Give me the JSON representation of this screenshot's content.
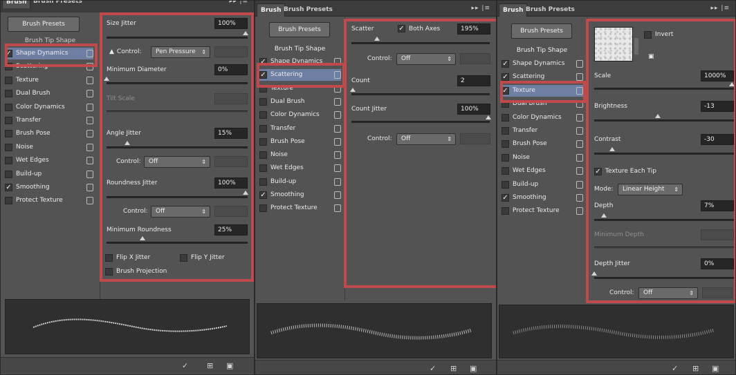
{
  "panel1": {
    "tabs": [
      "Brush",
      "Brush Presets"
    ],
    "presets_button": "Brush Presets",
    "tip_shape": "Brush Tip Shape",
    "list": [
      {
        "label": "Shape Dynamics",
        "checked": true
      },
      {
        "label": "Scattering",
        "checked": false
      },
      {
        "label": "Texture",
        "checked": false
      },
      {
        "label": "Dual Brush",
        "checked": false
      },
      {
        "label": "Color Dynamics",
        "checked": false
      },
      {
        "label": "Transfer",
        "checked": false
      },
      {
        "label": "Brush Pose",
        "checked": false
      },
      {
        "label": "Noise",
        "checked": false
      },
      {
        "label": "Wet Edges",
        "checked": false
      },
      {
        "label": "Build-up",
        "checked": false
      },
      {
        "label": "Smoothing",
        "checked": true
      },
      {
        "label": "Protect Texture",
        "checked": false
      }
    ],
    "size_jitter": {
      "label": "Size Jitter",
      "value": "100%"
    },
    "control1": {
      "label": "Control:",
      "value": "Pen Pressure"
    },
    "min_diameter": {
      "label": "Minimum Diameter",
      "value": "0%"
    },
    "tilt_scale": {
      "label": "Tilt Scale"
    },
    "angle_jitter": {
      "label": "Angle Jitter",
      "value": "15%"
    },
    "control2": {
      "label": "Control:",
      "value": "Off"
    },
    "roundness_jitter": {
      "label": "Roundness Jitter",
      "value": "100%"
    },
    "control3": {
      "label": "Control:",
      "value": "Off"
    },
    "min_roundness": {
      "label": "Minimum Roundness",
      "value": "25%"
    },
    "flip_x": "Flip X Jitter",
    "flip_y": "Flip Y Jitter",
    "brush_projection": "Brush Projection"
  },
  "panel2": {
    "tabs": [
      "Brush",
      "Brush Presets"
    ],
    "presets_button": "Brush Presets",
    "tip_shape": "Brush Tip Shape",
    "list": [
      {
        "label": "Shape Dynamics",
        "checked": true
      },
      {
        "label": "Scattering",
        "checked": true
      },
      {
        "label": "Texture",
        "checked": false
      },
      {
        "label": "Dual Brush",
        "checked": false
      },
      {
        "label": "Color Dynamics",
        "checked": false
      },
      {
        "label": "Transfer",
        "checked": false
      },
      {
        "label": "Brush Pose",
        "checked": false
      },
      {
        "label": "Noise",
        "checked": false
      },
      {
        "label": "Wet Edges",
        "checked": false
      },
      {
        "label": "Build-up",
        "checked": false
      },
      {
        "label": "Smoothing",
        "checked": true
      },
      {
        "label": "Protect Texture",
        "checked": false
      }
    ],
    "scatter": {
      "label": "Scatter",
      "both_axes": "Both Axes",
      "value": "195%"
    },
    "control1": {
      "label": "Control:",
      "value": "Off"
    },
    "count": {
      "label": "Count",
      "value": "2"
    },
    "count_jitter": {
      "label": "Count Jitter",
      "value": "100%"
    },
    "control2": {
      "label": "Control:",
      "value": "Off"
    }
  },
  "panel3": {
    "tabs": [
      "Brush",
      "Brush Presets"
    ],
    "presets_button": "Brush Presets",
    "tip_shape": "Brush Tip Shape",
    "list": [
      {
        "label": "Shape Dynamics",
        "checked": true
      },
      {
        "label": "Scattering",
        "checked": true
      },
      {
        "label": "Texture",
        "checked": true
      },
      {
        "label": "Dual Brush",
        "checked": false
      },
      {
        "label": "Color Dynamics",
        "checked": false
      },
      {
        "label": "Transfer",
        "checked": false
      },
      {
        "label": "Brush Pose",
        "checked": false
      },
      {
        "label": "Noise",
        "checked": false
      },
      {
        "label": "Wet Edges",
        "checked": false
      },
      {
        "label": "Build-up",
        "checked": false
      },
      {
        "label": "Smoothing",
        "checked": true
      },
      {
        "label": "Protect Texture",
        "checked": false
      }
    ],
    "invert": "Invert",
    "scale": {
      "label": "Scale",
      "value": "1000%"
    },
    "brightness": {
      "label": "Brightness",
      "value": "-13"
    },
    "contrast": {
      "label": "Contrast",
      "value": "-30"
    },
    "texture_each_tip": "Texture Each Tip",
    "mode": {
      "label": "Mode:",
      "value": "Linear Height"
    },
    "depth": {
      "label": "Depth",
      "value": "7%"
    },
    "min_depth": {
      "label": "Minimum Depth"
    },
    "depth_jitter": {
      "label": "Depth Jitter",
      "value": "0%"
    },
    "control": {
      "label": "Control:",
      "value": "Off"
    }
  },
  "icons": {
    "check": "✓",
    "lock": "⊡",
    "warning": "▲",
    "arrows": "⇕",
    "tab_menu": "▸▸ |≡",
    "new_brush": "▣",
    "create": "⊞",
    "eye_brush": "✓"
  },
  "colors": {
    "highlight_red": "#c0494b",
    "selected_row": "#6e7fa3",
    "panel_bg": "#535353"
  }
}
